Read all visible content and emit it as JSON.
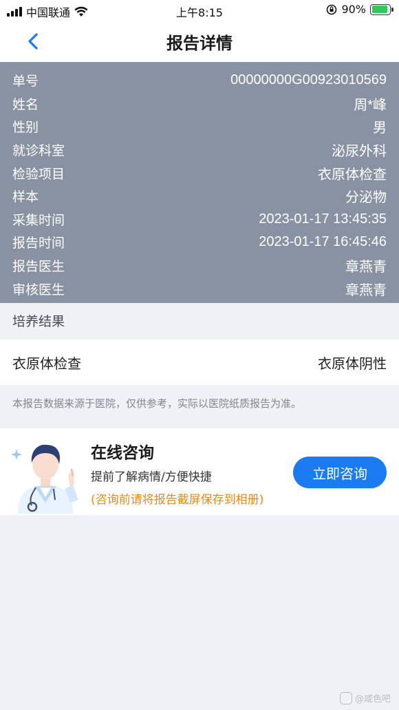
{
  "status_bar": {
    "carrier": "中国联通",
    "time": "上午8:15",
    "battery": "90%"
  },
  "nav": {
    "title": "报告详情"
  },
  "report_info": [
    {
      "label": "单号",
      "value": "00000000G00923010569"
    },
    {
      "label": "姓名",
      "value": "周*峰"
    },
    {
      "label": "性别",
      "value": "男"
    },
    {
      "label": "就诊科室",
      "value": "泌尿外科"
    },
    {
      "label": "检验项目",
      "value": "衣原体检查"
    },
    {
      "label": "样本",
      "value": "分泌物"
    },
    {
      "label": "采集时间",
      "value": "2023-01-17 13:45:35"
    },
    {
      "label": "报告时间",
      "value": "2023-01-17 16:45:46"
    },
    {
      "label": "报告医生",
      "value": "章燕青"
    },
    {
      "label": "审核医生",
      "value": "章燕青"
    }
  ],
  "culture": {
    "section_title": "培养结果",
    "item": "衣原体检查",
    "result": "衣原体阴性"
  },
  "disclaimer": "本报告数据来源于医院，仅供参考，实际以医院纸质报告为准。",
  "consult": {
    "title": "在线咨询",
    "subtitle": "提前了解病情/方便快捷",
    "note": "(咨询前请将报告截屏保存到相册)",
    "button": "立即咨询"
  },
  "watermark": "@咸色吧",
  "colors": {
    "panel_bg": "#8892a2",
    "accent": "#1a7cf0",
    "note": "#e88a1a",
    "page_bg": "#f0f1f5"
  }
}
